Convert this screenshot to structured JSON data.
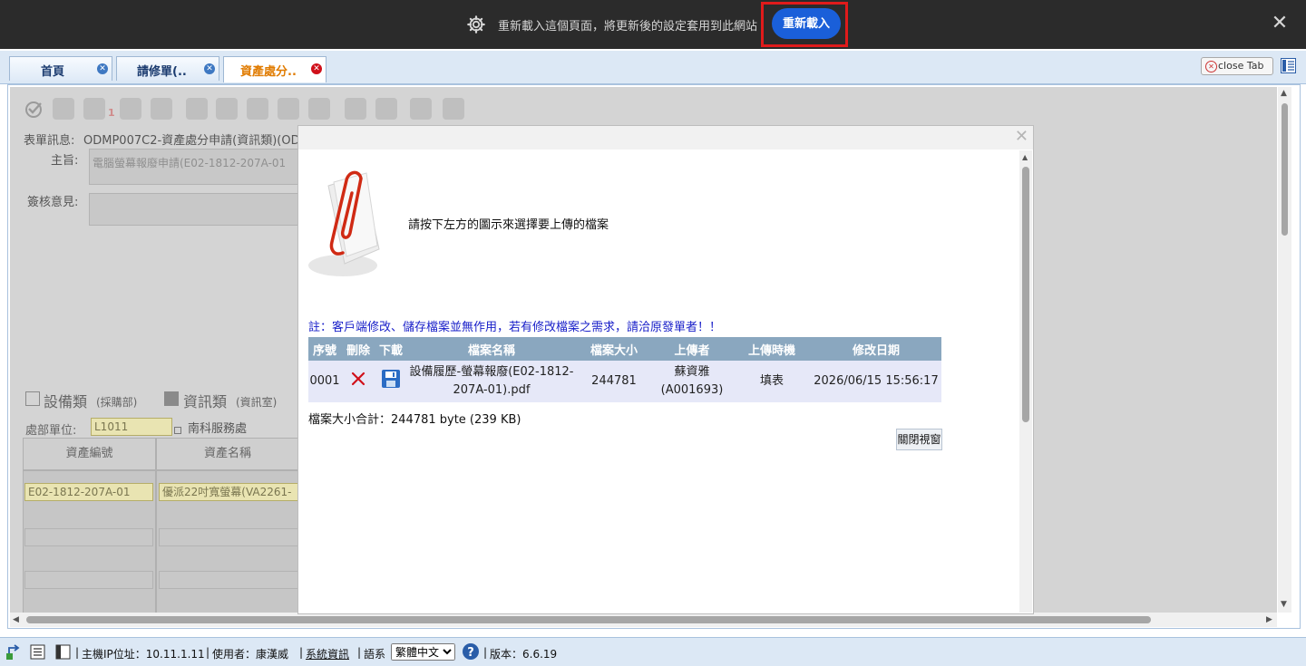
{
  "reload_bar": {
    "message": "重新載入這個頁面，將更新後的設定套用到此網站",
    "reload_button": "重新載入",
    "icon": "gear-icon",
    "close_icon": "close-icon"
  },
  "tabs": [
    {
      "label": "首頁"
    },
    {
      "label": "請修單(.."
    },
    {
      "label": "資產處分.."
    }
  ],
  "close_tab_button": "close Tab",
  "form": {
    "form_info_label": "表單訊息:",
    "form_info_value": "ODMP007C2-資產處分申請(資訊類)(OD",
    "subject_label": "主旨:",
    "subject_value": "電腦螢幕報廢申請(E02-1812-207A-01",
    "opinion_label": "簽核意見:",
    "badge_number": "1",
    "category_equipment": "設備類",
    "category_equipment_dept": "(採購部)",
    "category_it": "資訊類",
    "category_it_dept": "(資訊室)",
    "dept_label": "處部單位:",
    "dept_code": "L1011",
    "dept_name": "南科服務處",
    "grid_headers": [
      "資產編號",
      "資產名稱"
    ],
    "grid_row": [
      "E02-1812-207A-01",
      "優派22吋寬螢幕(VA2261-"
    ]
  },
  "dialog": {
    "instruction": "請按下左方的圖示來選擇要上傳的檔案",
    "note": "註：客戶端修改、儲存檔案並無作用，若有修改檔案之需求，請洽原發單者！！",
    "columns": [
      "序號",
      "刪除",
      "下載",
      "檔案名稱",
      "檔案大小",
      "上傳者",
      "上傳時機",
      "修改日期"
    ],
    "files": [
      {
        "seq": "0001",
        "name": "設備履歷-螢幕報廢(E02-1812-207A-01).pdf",
        "size": "244781",
        "uploader": "蘇資雅\n(A001693)",
        "timing": "填表",
        "modified": "2026/06/15 15:56:17"
      }
    ],
    "total": "檔案大小合計：244781 byte (239 KB)",
    "close_button": "關閉視窗"
  },
  "status_bar": {
    "host_ip": "主機IP位址：10.11.1.11",
    "user": "使用者：康漢威",
    "system_info": "系統資訊",
    "language_label": "語系",
    "language_selected": "繁體中文",
    "version": "版本：6.6.19"
  }
}
